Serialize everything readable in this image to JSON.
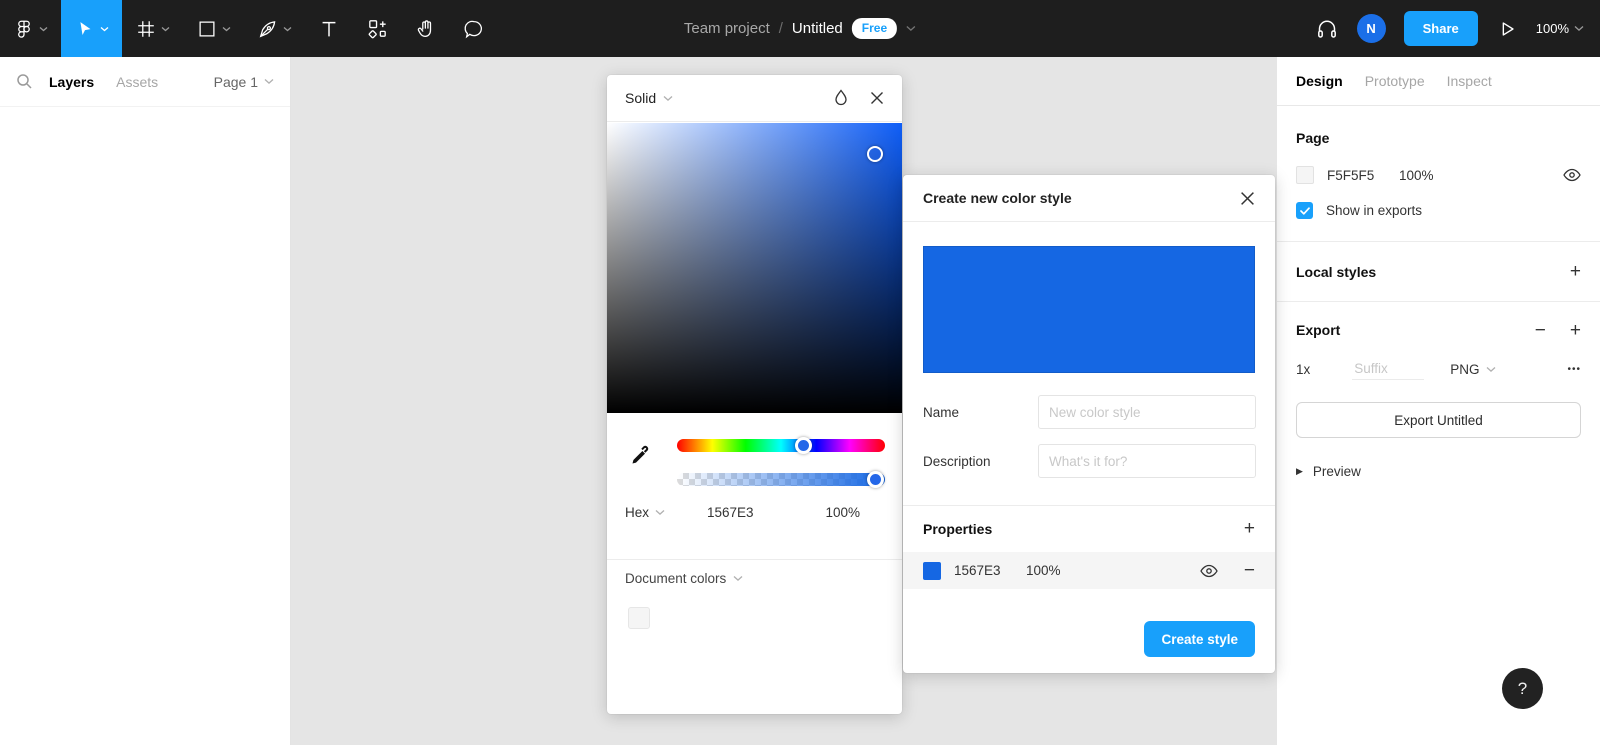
{
  "colors": {
    "accent_blue": "#18A0FB",
    "style_blue": "#1567E3",
    "page_color": "#F5F5F5",
    "topbar_bg": "#1e1e1e",
    "canvas_bg": "#e5e5e5"
  },
  "topbar": {
    "breadcrumb": {
      "project": "Team project",
      "separator": "/",
      "file": "Untitled",
      "plan_badge": "Free"
    },
    "avatar_initial": "N",
    "share_label": "Share",
    "zoom_level": "100%"
  },
  "left_sidebar": {
    "tabs": [
      {
        "label": "Layers"
      },
      {
        "label": "Assets"
      }
    ],
    "page_selector": "Page 1"
  },
  "color_picker": {
    "mode": "Solid",
    "hex_label": "Hex",
    "hex_value": "1567E3",
    "opacity_value": "100%",
    "document_colors_label": "Document colors"
  },
  "style_dialog": {
    "title": "Create new color style",
    "name_label": "Name",
    "name_placeholder": "New color style",
    "description_label": "Description",
    "description_placeholder": "What's it for?",
    "properties_label": "Properties",
    "property_row": {
      "hex": "1567E3",
      "opacity": "100%"
    },
    "create_button": "Create style"
  },
  "right_panel": {
    "tabs": [
      {
        "label": "Design"
      },
      {
        "label": "Prototype"
      },
      {
        "label": "Inspect"
      }
    ],
    "page_section": {
      "title": "Page",
      "color_hex": "F5F5F5",
      "opacity": "100%",
      "checkbox_label": "Show in exports"
    },
    "local_styles": {
      "title": "Local styles"
    },
    "export_section": {
      "title": "Export",
      "scale": "1x",
      "suffix_placeholder": "Suffix",
      "format": "PNG",
      "export_button": "Export Untitled",
      "preview_label": "Preview"
    }
  },
  "icons": {
    "plus": "+",
    "minus": "−",
    "ellipsis": "•••",
    "collapsed_arrow": "▶"
  },
  "help_button": "?"
}
